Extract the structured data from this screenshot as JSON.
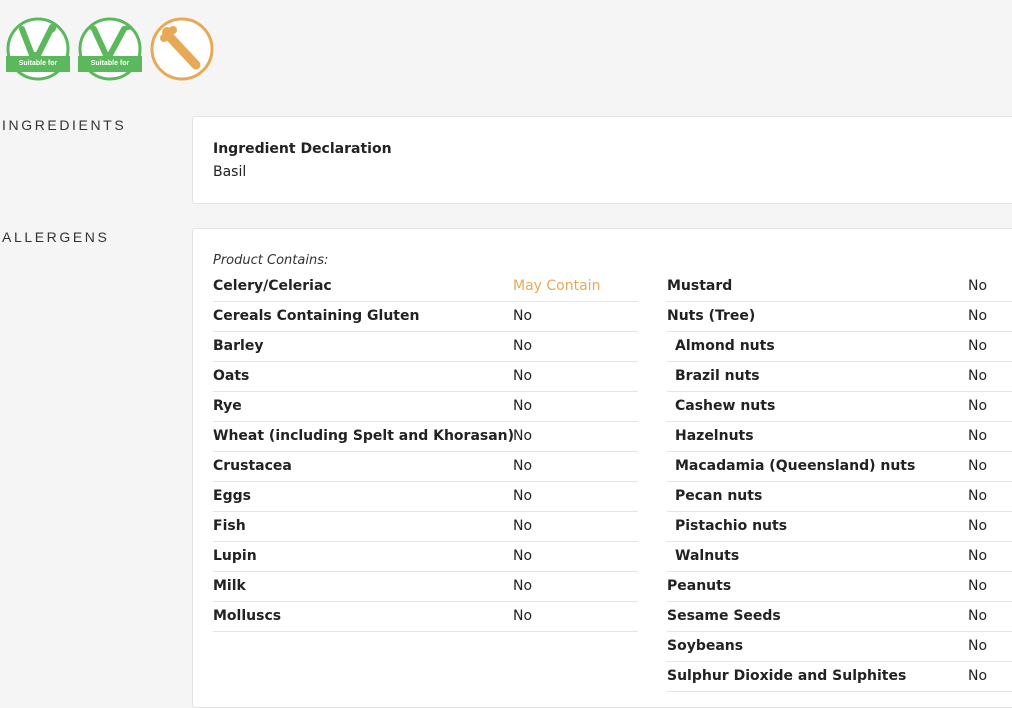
{
  "badges": [
    {
      "icon": "vegetarian-v-icon",
      "label": "Suitable for",
      "color": "#5cb85c"
    },
    {
      "icon": "vegan-v-icon",
      "label": "Suitable for",
      "color": "#5cb85c"
    },
    {
      "icon": "celery-allergen-icon",
      "color": "#e8a956"
    }
  ],
  "ingredients": {
    "section_label": "INGREDIENTS",
    "declaration_title": "Ingredient Declaration",
    "declaration_value": "Basil"
  },
  "allergens": {
    "section_label": "ALLERGENS",
    "contains_label": "Product Contains:",
    "left": [
      {
        "name": "Celery/Celeriac",
        "value": "May Contain"
      },
      {
        "name": "Cereals Containing Gluten",
        "value": "No"
      },
      {
        "name": "Barley",
        "value": "No"
      },
      {
        "name": "Oats",
        "value": "No"
      },
      {
        "name": "Rye",
        "value": "No"
      },
      {
        "name": "Wheat (including Spelt and Khorasan)",
        "value": "No"
      },
      {
        "name": "Crustacea",
        "value": "No"
      },
      {
        "name": "Eggs",
        "value": "No"
      },
      {
        "name": "Fish",
        "value": "No"
      },
      {
        "name": "Lupin",
        "value": "No"
      },
      {
        "name": "Milk",
        "value": "No"
      },
      {
        "name": "Molluscs",
        "value": "No"
      }
    ],
    "right": [
      {
        "name": "Mustard",
        "value": "No"
      },
      {
        "name": "Nuts (Tree)",
        "value": "No"
      },
      {
        "name": "Almond nuts",
        "value": "No"
      },
      {
        "name": "Brazil nuts",
        "value": "No"
      },
      {
        "name": "Cashew nuts",
        "value": "No"
      },
      {
        "name": "Hazelnuts",
        "value": "No"
      },
      {
        "name": "Macadamia (Queensland) nuts",
        "value": "No"
      },
      {
        "name": "Pecan nuts",
        "value": "No"
      },
      {
        "name": "Pistachio nuts",
        "value": "No"
      },
      {
        "name": "Walnuts",
        "value": "No"
      },
      {
        "name": "Peanuts",
        "value": "No"
      },
      {
        "name": "Sesame Seeds",
        "value": "No"
      },
      {
        "name": "Soybeans",
        "value": "No"
      },
      {
        "name": "Sulphur Dioxide and Sulphites",
        "value": "No"
      }
    ],
    "colors": {
      "may_contain": "#e8a956"
    }
  }
}
